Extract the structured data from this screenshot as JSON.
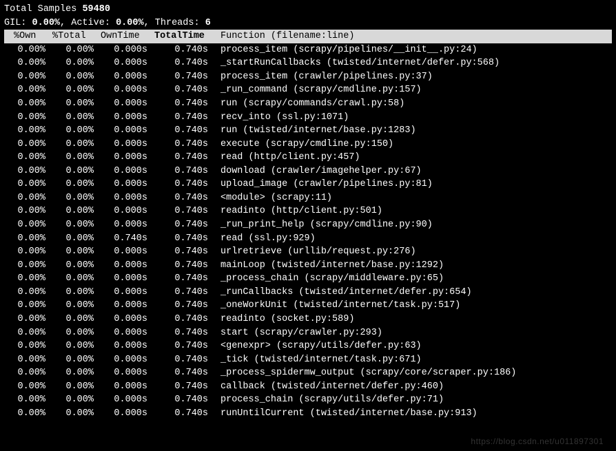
{
  "stats": {
    "total_samples_label": "Total Samples",
    "total_samples_value": "59480",
    "gil_label": "GIL:",
    "gil_value": "0.00%",
    "active_label": "Active:",
    "active_value": "0.00%",
    "threads_label": "Threads:",
    "threads_value": "6"
  },
  "headers": {
    "own": "%Own",
    "total": "%Total",
    "owntime": "OwnTime",
    "totaltime": "TotalTime",
    "function": "Function (filename:line)"
  },
  "rows": [
    {
      "own": "0.00%",
      "total": "0.00%",
      "owntime": "0.000s",
      "totaltime": "0.740s",
      "func": "process_item (scrapy/pipelines/__init__.py:24)"
    },
    {
      "own": "0.00%",
      "total": "0.00%",
      "owntime": "0.000s",
      "totaltime": "0.740s",
      "func": "_startRunCallbacks (twisted/internet/defer.py:568)"
    },
    {
      "own": "0.00%",
      "total": "0.00%",
      "owntime": "0.000s",
      "totaltime": "0.740s",
      "func": "process_item (crawler/pipelines.py:37)"
    },
    {
      "own": "0.00%",
      "total": "0.00%",
      "owntime": "0.000s",
      "totaltime": "0.740s",
      "func": "_run_command (scrapy/cmdline.py:157)"
    },
    {
      "own": "0.00%",
      "total": "0.00%",
      "owntime": "0.000s",
      "totaltime": "0.740s",
      "func": "run (scrapy/commands/crawl.py:58)"
    },
    {
      "own": "0.00%",
      "total": "0.00%",
      "owntime": "0.000s",
      "totaltime": "0.740s",
      "func": "recv_into (ssl.py:1071)"
    },
    {
      "own": "0.00%",
      "total": "0.00%",
      "owntime": "0.000s",
      "totaltime": "0.740s",
      "func": "run (twisted/internet/base.py:1283)"
    },
    {
      "own": "0.00%",
      "total": "0.00%",
      "owntime": "0.000s",
      "totaltime": "0.740s",
      "func": "execute (scrapy/cmdline.py:150)"
    },
    {
      "own": "0.00%",
      "total": "0.00%",
      "owntime": "0.000s",
      "totaltime": "0.740s",
      "func": "read (http/client.py:457)"
    },
    {
      "own": "0.00%",
      "total": "0.00%",
      "owntime": "0.000s",
      "totaltime": "0.740s",
      "func": "download (crawler/imagehelper.py:67)"
    },
    {
      "own": "0.00%",
      "total": "0.00%",
      "owntime": "0.000s",
      "totaltime": "0.740s",
      "func": "upload_image (crawler/pipelines.py:81)"
    },
    {
      "own": "0.00%",
      "total": "0.00%",
      "owntime": "0.000s",
      "totaltime": "0.740s",
      "func": "<module> (scrapy:11)"
    },
    {
      "own": "0.00%",
      "total": "0.00%",
      "owntime": "0.000s",
      "totaltime": "0.740s",
      "func": "readinto (http/client.py:501)"
    },
    {
      "own": "0.00%",
      "total": "0.00%",
      "owntime": "0.000s",
      "totaltime": "0.740s",
      "func": "_run_print_help (scrapy/cmdline.py:90)"
    },
    {
      "own": "0.00%",
      "total": "0.00%",
      "owntime": "0.740s",
      "totaltime": "0.740s",
      "func": "read (ssl.py:929)"
    },
    {
      "own": "0.00%",
      "total": "0.00%",
      "owntime": "0.000s",
      "totaltime": "0.740s",
      "func": "urlretrieve (urllib/request.py:276)"
    },
    {
      "own": "0.00%",
      "total": "0.00%",
      "owntime": "0.000s",
      "totaltime": "0.740s",
      "func": "mainLoop (twisted/internet/base.py:1292)"
    },
    {
      "own": "0.00%",
      "total": "0.00%",
      "owntime": "0.000s",
      "totaltime": "0.740s",
      "func": "_process_chain (scrapy/middleware.py:65)"
    },
    {
      "own": "0.00%",
      "total": "0.00%",
      "owntime": "0.000s",
      "totaltime": "0.740s",
      "func": "_runCallbacks (twisted/internet/defer.py:654)"
    },
    {
      "own": "0.00%",
      "total": "0.00%",
      "owntime": "0.000s",
      "totaltime": "0.740s",
      "func": "_oneWorkUnit (twisted/internet/task.py:517)"
    },
    {
      "own": "0.00%",
      "total": "0.00%",
      "owntime": "0.000s",
      "totaltime": "0.740s",
      "func": "readinto (socket.py:589)"
    },
    {
      "own": "0.00%",
      "total": "0.00%",
      "owntime": "0.000s",
      "totaltime": "0.740s",
      "func": "start (scrapy/crawler.py:293)"
    },
    {
      "own": "0.00%",
      "total": "0.00%",
      "owntime": "0.000s",
      "totaltime": "0.740s",
      "func": "<genexpr> (scrapy/utils/defer.py:63)"
    },
    {
      "own": "0.00%",
      "total": "0.00%",
      "owntime": "0.000s",
      "totaltime": "0.740s",
      "func": "_tick (twisted/internet/task.py:671)"
    },
    {
      "own": "0.00%",
      "total": "0.00%",
      "owntime": "0.000s",
      "totaltime": "0.740s",
      "func": "_process_spidermw_output (scrapy/core/scraper.py:186)"
    },
    {
      "own": "0.00%",
      "total": "0.00%",
      "owntime": "0.000s",
      "totaltime": "0.740s",
      "func": "callback (twisted/internet/defer.py:460)"
    },
    {
      "own": "0.00%",
      "total": "0.00%",
      "owntime": "0.000s",
      "totaltime": "0.740s",
      "func": "process_chain (scrapy/utils/defer.py:71)"
    },
    {
      "own": "0.00%",
      "total": "0.00%",
      "owntime": "0.000s",
      "totaltime": "0.740s",
      "func": "runUntilCurrent (twisted/internet/base.py:913)"
    }
  ],
  "watermark": "https://blog.csdn.net/u011897301"
}
